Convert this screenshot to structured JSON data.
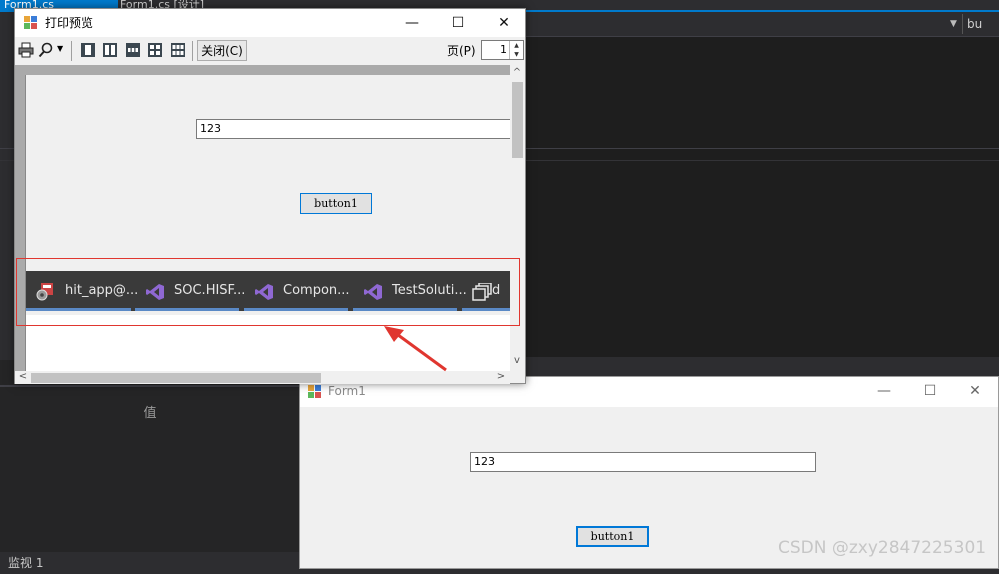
{
  "ide": {
    "tab_active": "Form1.cs",
    "tab_design": "Form1.cs [设计]",
    "member_combo": "bu",
    "value_column": "值",
    "watch_tab": "监视 1"
  },
  "print_preview": {
    "title": "打印预览",
    "close_button": "关闭(C)",
    "page_label": "页(P)",
    "page_value": "1",
    "textbox_value": "123",
    "button_label": "button1",
    "taskbar_items": [
      {
        "label": "hit_app@...",
        "icon": "app-gear-icon"
      },
      {
        "label": "SOC.HISF...",
        "icon": "visual-studio-icon"
      },
      {
        "label": "Compon...",
        "icon": "visual-studio-icon"
      },
      {
        "label": "TestSoluti...",
        "icon": "visual-studio-icon"
      },
      {
        "label": "d",
        "icon": "windows-stack-icon"
      }
    ]
  },
  "form1": {
    "title": "Form1",
    "textbox_value": "123",
    "button_label": "button1"
  },
  "watermark": "CSDN @zxy2847225301",
  "colors": {
    "accent": "#007acc",
    "highlight_red": "#e0362f",
    "vs_purple": "#8f68d3"
  }
}
